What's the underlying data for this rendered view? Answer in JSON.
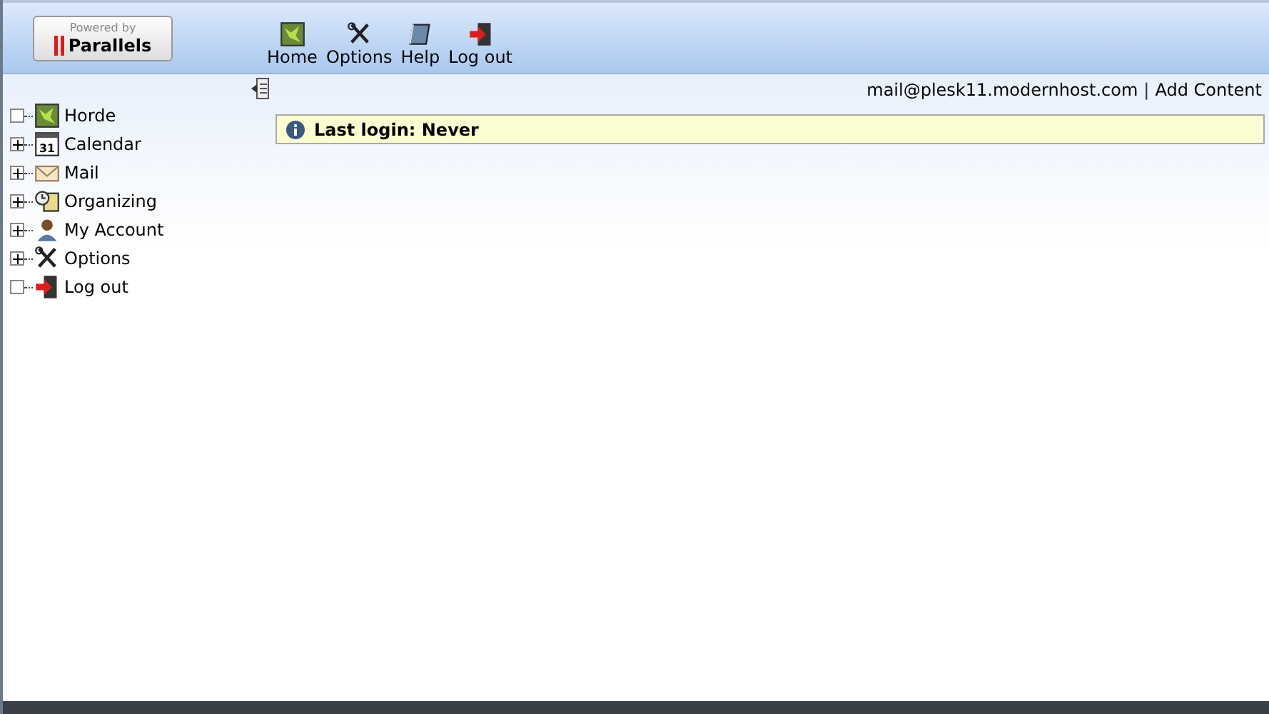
{
  "header": {
    "logo": {
      "caption": "Powered by",
      "brand": "Parallels"
    },
    "nav": [
      {
        "label": "Home",
        "kind": "map"
      },
      {
        "label": "Options",
        "kind": "tools"
      },
      {
        "label": "Help",
        "kind": "book"
      },
      {
        "label": "Log out",
        "kind": "exit"
      }
    ]
  },
  "sidebar": {
    "items": [
      {
        "label": "Horde",
        "kind": "map",
        "expandable": false
      },
      {
        "label": "Calendar",
        "kind": "calendar",
        "calendar_day": "31",
        "expandable": true
      },
      {
        "label": "Mail",
        "kind": "mail",
        "expandable": true
      },
      {
        "label": "Organizing",
        "kind": "clock",
        "expandable": true
      },
      {
        "label": "My Account",
        "kind": "person",
        "expandable": true
      },
      {
        "label": "Options",
        "kind": "tools",
        "expandable": true
      },
      {
        "label": "Log out",
        "kind": "exit",
        "expandable": false
      }
    ]
  },
  "topbar": {
    "user": "mail@plesk11.modernhost.com",
    "separator": "|",
    "link": "Add Content"
  },
  "notice": {
    "text": "Last login: Never"
  }
}
